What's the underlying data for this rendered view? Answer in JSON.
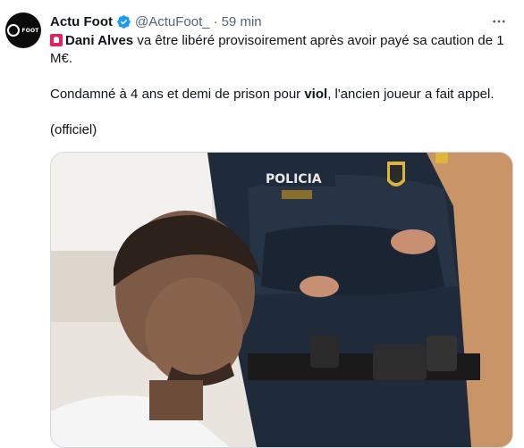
{
  "tweet": {
    "author_name": "Actu Foot",
    "handle": "@ActuFoot_",
    "separator": "·",
    "time": "59 min",
    "avatar_text": "FOOT",
    "line1_name": "Dani Alves",
    "line1_rest": " va être libéré provisoirement après avoir payé sa caution de 1 M€.",
    "line2_pre": "Condamné à 4 ans et demi de prison pour ",
    "line2_bold": "viol",
    "line2_post": ", l'ancien joueur a fait appel.",
    "line3": "(officiel)"
  },
  "media": {
    "badge_text": "POLICIA",
    "icons": [
      "verified-badge-icon",
      "more-options-icon",
      "siren-emoji-icon"
    ]
  }
}
